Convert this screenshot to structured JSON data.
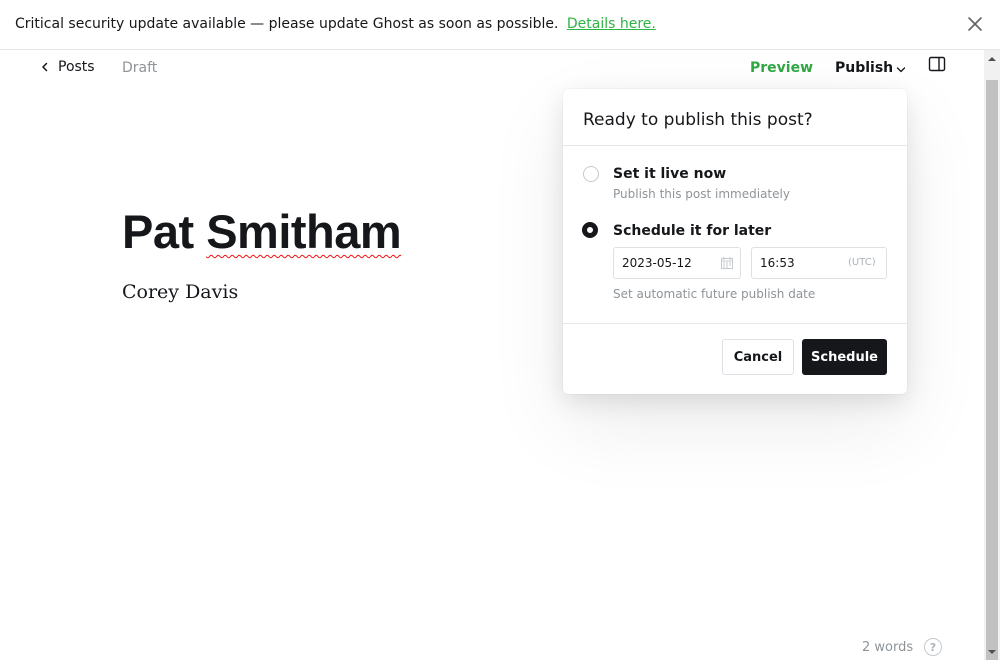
{
  "banner": {
    "message": "Critical security update available — please update Ghost as soon as possible.",
    "link_text": "Details here.",
    "close_icon": "close-icon"
  },
  "toolbar": {
    "back_label": "Posts",
    "status": "Draft",
    "preview_label": "Preview",
    "publish_label": "Publish"
  },
  "editor": {
    "title_part1": "Pat ",
    "title_part2": "Smitham",
    "body": "Corey Davis"
  },
  "footer": {
    "word_count": "2 words",
    "help_label": "?"
  },
  "publish_menu": {
    "title": "Ready to publish this post?",
    "options": [
      {
        "label": "Set it live now",
        "description": "Publish this post immediately",
        "selected": false
      },
      {
        "label": "Schedule it for later",
        "description": "Set automatic future publish date",
        "selected": true
      }
    ],
    "date_value": "2023-05-12",
    "time_value": "16:53",
    "timezone": "(UTC)",
    "cancel_label": "Cancel",
    "schedule_label": "Schedule"
  },
  "colors": {
    "accent_green": "#30a843",
    "text_dark": "#15171a",
    "muted": "#8e9499"
  }
}
